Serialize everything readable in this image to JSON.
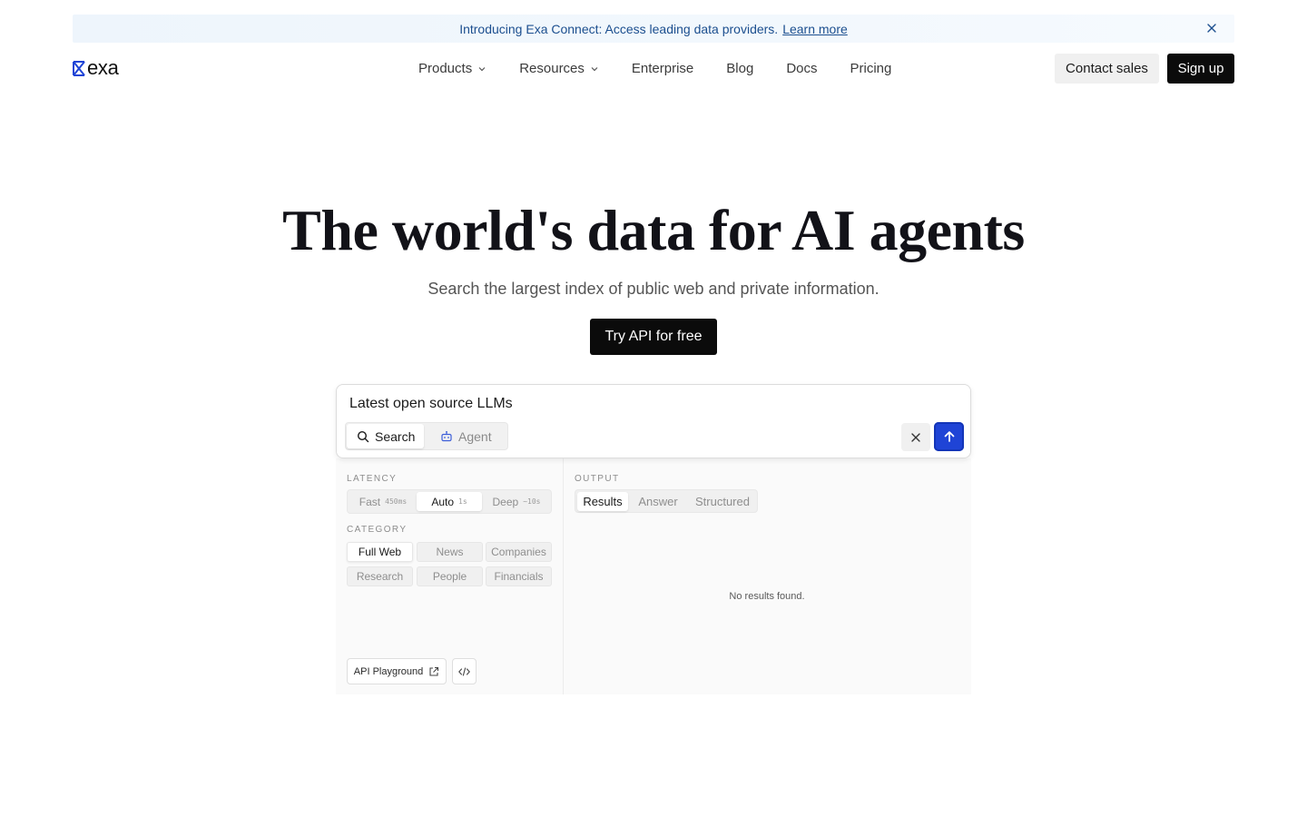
{
  "banner": {
    "text": "Introducing Exa Connect: Access leading data providers.",
    "link": "Learn more",
    "close_icon": "close-icon"
  },
  "logo": {
    "word": "exa",
    "mark_color": "#1f44d6"
  },
  "nav": {
    "items": [
      {
        "label": "Products",
        "has_dropdown": true
      },
      {
        "label": "Resources",
        "has_dropdown": true
      },
      {
        "label": "Enterprise",
        "has_dropdown": false
      },
      {
        "label": "Blog",
        "has_dropdown": false
      },
      {
        "label": "Docs",
        "has_dropdown": false
      },
      {
        "label": "Pricing",
        "has_dropdown": false
      }
    ],
    "contact_sales": "Contact sales",
    "sign_up": "Sign up"
  },
  "hero": {
    "title": "The world's data for AI agents",
    "subtitle": "Search the largest index of public web and private information.",
    "cta": "Try API for free"
  },
  "search": {
    "query": "Latest open source LLMs",
    "modes": [
      {
        "label": "Search",
        "icon": "search-icon",
        "active": true
      },
      {
        "label": "Agent",
        "icon": "robot-icon",
        "active": false
      }
    ],
    "clear_icon": "close-icon",
    "submit_icon": "arrow-up-icon",
    "submit_color": "#1f44d6"
  },
  "latency": {
    "label": "LATENCY",
    "options": [
      {
        "label": "Fast",
        "hint": "450ms",
        "active": false
      },
      {
        "label": "Auto",
        "hint": "1s",
        "active": true
      },
      {
        "label": "Deep",
        "hint": "~10s",
        "active": false
      }
    ]
  },
  "category": {
    "label": "CATEGORY",
    "options": [
      {
        "label": "Full Web",
        "active": true
      },
      {
        "label": "News",
        "active": false
      },
      {
        "label": "Companies",
        "active": false
      },
      {
        "label": "Research",
        "active": false
      },
      {
        "label": "People",
        "active": false
      },
      {
        "label": "Financials",
        "active": false
      }
    ]
  },
  "output": {
    "label": "OUTPUT",
    "options": [
      {
        "label": "Results",
        "active": true
      },
      {
        "label": "Answer",
        "active": false
      },
      {
        "label": "Structured",
        "active": false
      }
    ],
    "empty_message": "No results found."
  },
  "footer_actions": {
    "playground": "API Playground",
    "playground_icon": "external-link-icon",
    "code_icon": "code-icon"
  }
}
